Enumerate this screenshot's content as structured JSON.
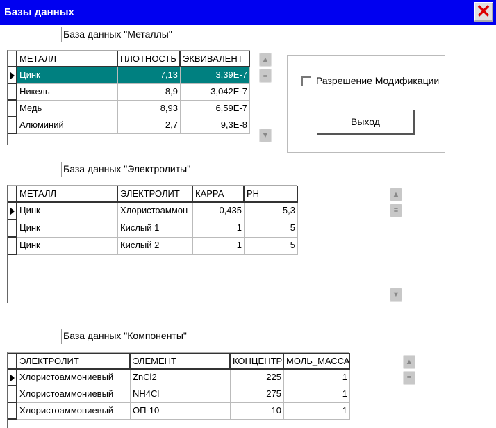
{
  "window": {
    "title": "Базы данных"
  },
  "metals": {
    "label": "База данных \"Металлы\"",
    "columns": [
      "МЕТАЛЛ",
      "ПЛОТНОСТЬ",
      "ЭКВИВАЛЕНТ"
    ],
    "rows": [
      [
        "Цинк",
        "7,13",
        "3,39E-7"
      ],
      [
        "Никель",
        "8,9",
        "3,042E-7"
      ],
      [
        "Медь",
        "8,93",
        "6,59E-7"
      ],
      [
        "Алюминий",
        "2,7",
        "9,3E-8"
      ]
    ]
  },
  "electrolytes": {
    "label": "База данных \"Электролиты\"",
    "columns": [
      "МЕТАЛЛ",
      "ЭЛЕКТРОЛИТ",
      "КАРРА",
      "PH"
    ],
    "rows": [
      [
        "Цинк",
        "Хлористоаммон",
        "0,435",
        "5,3"
      ],
      [
        "Цинк",
        "Кислый 1",
        "1",
        "5"
      ],
      [
        "Цинк",
        "Кислый 2",
        "1",
        "5"
      ]
    ]
  },
  "components": {
    "label": "База данных \"Компоненты\"",
    "columns": [
      "ЭЛЕКТРОЛИТ",
      "ЭЛЕМЕНТ",
      "КОНЦЕНТР",
      "МОЛЬ_МАССА"
    ],
    "rows": [
      [
        "Хлористоаммониевый",
        "ZnCl2",
        "225",
        "1"
      ],
      [
        "Хлористоаммониевый",
        "NH4Cl",
        "275",
        "1"
      ],
      [
        "Хлористоаммониевый",
        "ОП-10",
        "10",
        "1"
      ]
    ]
  },
  "controls": {
    "allow_modify": "Разрешение Модификации",
    "exit": "Выход"
  }
}
